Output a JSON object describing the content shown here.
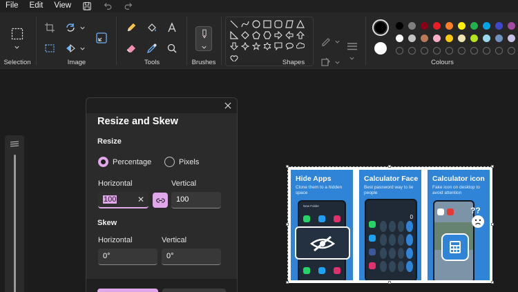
{
  "menu": {
    "file": "File",
    "edit": "Edit",
    "view": "View"
  },
  "ribbon": {
    "groups": {
      "selection": "Selection",
      "image": "Image",
      "tools": "Tools",
      "brushes": "Brushes",
      "shapes": "Shapes",
      "colours": "Colours"
    },
    "palette": {
      "row1": [
        "#000000",
        "#7f7f7f",
        "#880015",
        "#ed1c24",
        "#ff7f27",
        "#fff200",
        "#22b14c",
        "#00a2e8",
        "#3f48cc",
        "#a349a4"
      ],
      "row2": [
        "#ffffff",
        "#c3c3c3",
        "#b97a57",
        "#ffaec9",
        "#ffc90e",
        "#efe4b0",
        "#b5e61d",
        "#99d9ea",
        "#7092be",
        "#c8bfe7"
      ],
      "primary": "#000000",
      "secondary": "#ffffff",
      "accent": "#e0a7ea"
    }
  },
  "dialog": {
    "title": "Resize and Skew",
    "resize_section": "Resize",
    "radio_percentage": "Percentage",
    "radio_pixels": "Pixels",
    "horizontal_label": "Horizontal",
    "vertical_label": "Vertical",
    "horizontal_value": "100",
    "vertical_value": "100",
    "skew_section": "Skew",
    "skew_horizontal_label": "Horizontal",
    "skew_vertical_label": "Vertical",
    "skew_horizontal_value": "0°",
    "skew_vertical_value": "0°"
  },
  "image": {
    "panels": [
      {
        "title": "Hide Apps",
        "subtitle": "Clone them to a hidden space"
      },
      {
        "title": "Calculator Face",
        "subtitle": "Best password way to lie people"
      },
      {
        "title": "Calculator icon",
        "subtitle": "Fake icon on desktop to avoid attention"
      }
    ],
    "phone_header": "New Folder"
  }
}
